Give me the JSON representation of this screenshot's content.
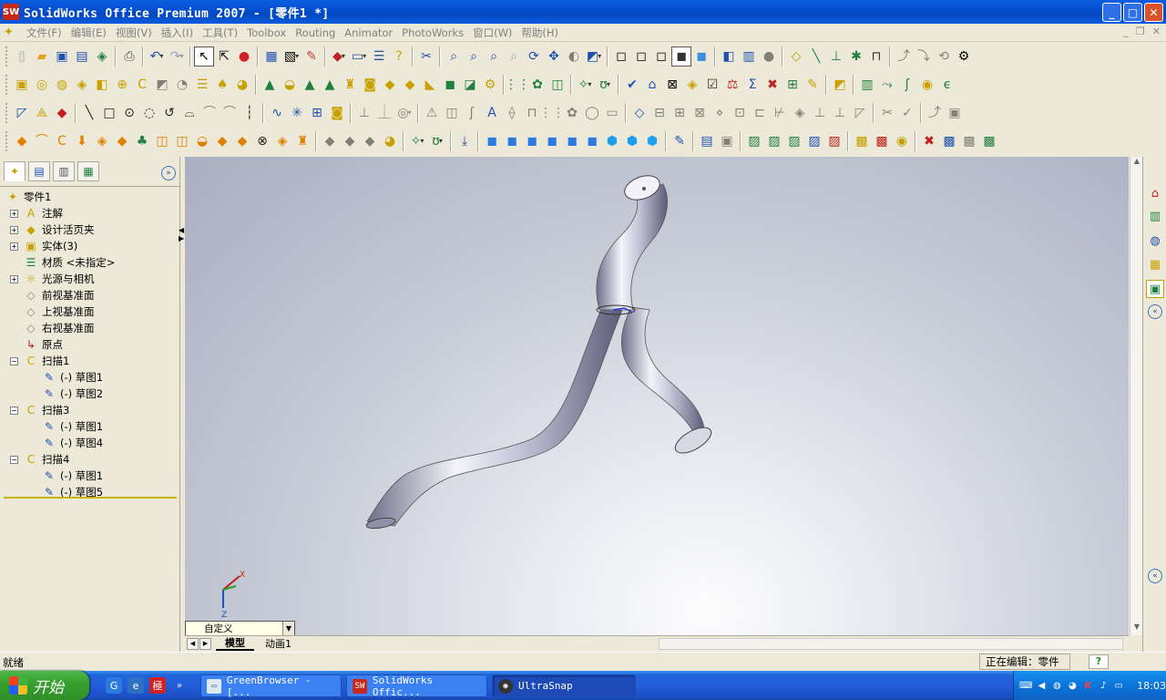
{
  "window": {
    "title": "SolidWorks Office Premium 2007 - [零件1 *]",
    "minimize": "_",
    "maximize": "□",
    "close": "✕"
  },
  "menu": [
    "文件(F)",
    "编辑(E)",
    "视图(V)",
    "插入(I)",
    "工具(T)",
    "Toolbox",
    "Routing",
    "Animator",
    "PhotoWorks",
    "窗口(W)",
    "帮助(H)"
  ],
  "feature_tree": {
    "root": "零件1",
    "items": [
      {
        "label": "注解",
        "icon": "annotation-icon",
        "level": 1,
        "expandable": true
      },
      {
        "label": "设计活页夹",
        "icon": "design-binder-icon",
        "level": 1,
        "expandable": true
      },
      {
        "label": "实体(3)",
        "icon": "solid-bodies-icon",
        "level": 1,
        "expandable": true
      },
      {
        "label": "材质 <未指定>",
        "icon": "material-icon",
        "level": 1,
        "expandable": false
      },
      {
        "label": "光源与相机",
        "icon": "lights-cameras-icon",
        "level": 1,
        "expandable": true
      },
      {
        "label": "前视基准面",
        "icon": "plane-icon",
        "level": 1,
        "expandable": false
      },
      {
        "label": "上视基准面",
        "icon": "plane-icon",
        "level": 1,
        "expandable": false
      },
      {
        "label": "右视基准面",
        "icon": "plane-icon",
        "level": 1,
        "expandable": false
      },
      {
        "label": "原点",
        "icon": "origin-icon",
        "level": 1,
        "expandable": false
      },
      {
        "label": "扫描1",
        "icon": "sweep-icon",
        "level": 1,
        "expandable": true,
        "expanded": true
      },
      {
        "label": "(-) 草图1",
        "icon": "sketch-icon",
        "level": 2,
        "expandable": false
      },
      {
        "label": "(-) 草图2",
        "icon": "sketch-icon",
        "level": 2,
        "expandable": false
      },
      {
        "label": "扫描3",
        "icon": "sweep-icon",
        "level": 1,
        "expandable": true,
        "expanded": true
      },
      {
        "label": "(-) 草图1",
        "icon": "sketch-icon",
        "level": 2,
        "expandable": false
      },
      {
        "label": "(-) 草图4",
        "icon": "sketch-icon",
        "level": 2,
        "expandable": false
      },
      {
        "label": "扫描4",
        "icon": "sweep-icon",
        "level": 1,
        "expandable": true,
        "expanded": true
      },
      {
        "label": "(-) 草图1",
        "icon": "sketch-icon",
        "level": 2,
        "expandable": false
      },
      {
        "label": "(-) 草图5",
        "icon": "sketch-icon",
        "level": 2,
        "expandable": false
      }
    ]
  },
  "viewport": {
    "configuration": "自定义",
    "triad": {
      "x": "X",
      "y": "Y",
      "z": "Z"
    }
  },
  "sheet_tabs": [
    "模型",
    "动画1"
  ],
  "status": {
    "left": "就绪",
    "right": "正在编辑：零件",
    "help": "?"
  },
  "taskbar": {
    "start": "开始",
    "tasks": [
      {
        "label": "GreenBrowser - [...",
        "active": false
      },
      {
        "label": "SolidWorks Offic...",
        "active": false
      },
      {
        "label": "UltraSnap",
        "active": true
      }
    ],
    "clock": "18:03"
  },
  "colors": {
    "titlebar": "#0450d0",
    "start_button": "#37a22f",
    "sweep_feature": "#e8b400",
    "sketch": "#2244cc"
  }
}
